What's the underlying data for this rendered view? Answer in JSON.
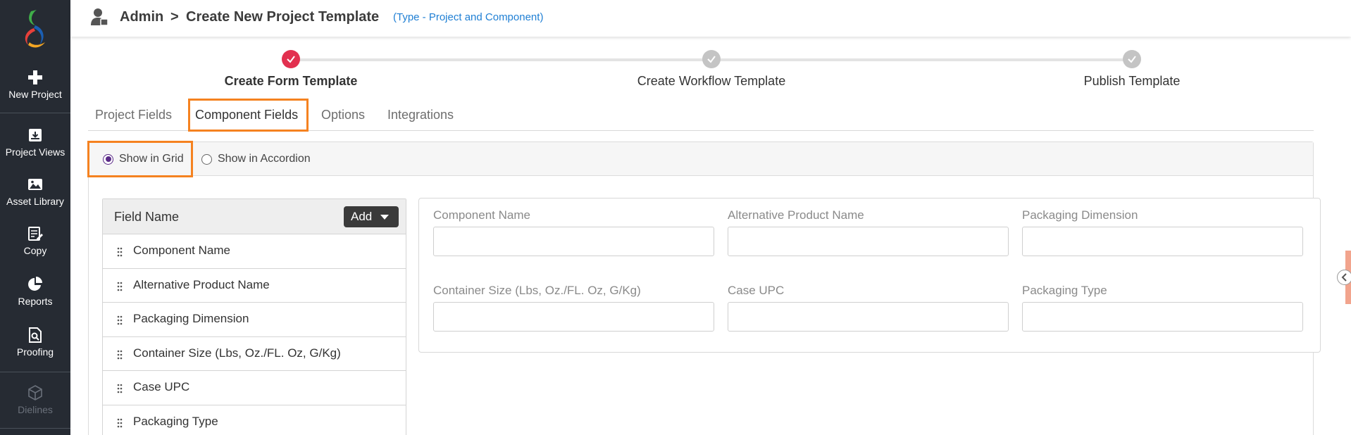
{
  "sidebar": {
    "items": [
      {
        "label": "New Project",
        "icon": "plus-icon"
      },
      {
        "label": "Project Views",
        "icon": "archive-icon"
      },
      {
        "label": "Asset Library",
        "icon": "image-icon"
      },
      {
        "label": "Copy",
        "icon": "edit-document-icon"
      },
      {
        "label": "Reports",
        "icon": "pie-chart-icon"
      },
      {
        "label": "Proofing",
        "icon": "search-document-icon"
      },
      {
        "label": "Dielines",
        "icon": "cube-icon",
        "disabled": true
      }
    ]
  },
  "header": {
    "section": "Admin",
    "separator": ">",
    "title": "Create New Project Template",
    "type_note": "(Type - Project and Component)"
  },
  "stepper": {
    "steps": [
      {
        "label": "Create Form Template",
        "active": true
      },
      {
        "label": "Create Workflow Template",
        "active": false
      },
      {
        "label": "Publish Template",
        "active": false
      }
    ]
  },
  "tabs": [
    {
      "label": "Project Fields"
    },
    {
      "label": "Component Fields",
      "active": true
    },
    {
      "label": "Options"
    },
    {
      "label": "Integrations"
    }
  ],
  "display_mode": {
    "options": [
      {
        "label": "Show in Grid",
        "checked": true
      },
      {
        "label": "Show in Accordion",
        "checked": false
      }
    ]
  },
  "field_list": {
    "header": "Field Name",
    "add_label": "Add",
    "fields": [
      "Component Name",
      "Alternative Product Name",
      "Packaging Dimension",
      "Container Size (Lbs, Oz./FL. Oz, G/Kg)",
      "Case UPC",
      "Packaging Type"
    ]
  },
  "preview": {
    "fields": [
      "Component Name",
      "Alternative Product Name",
      "Packaging Dimension",
      "Container Size (Lbs, Oz./FL. Oz, G/Kg)",
      "Case UPC",
      "Packaging Type"
    ]
  },
  "colors": {
    "sidebar_bg": "#262b33",
    "accent_step": "#e2304f",
    "highlight": "#f58220",
    "link_blue": "#1f7fd4",
    "radio_purple": "#5a2a87"
  }
}
